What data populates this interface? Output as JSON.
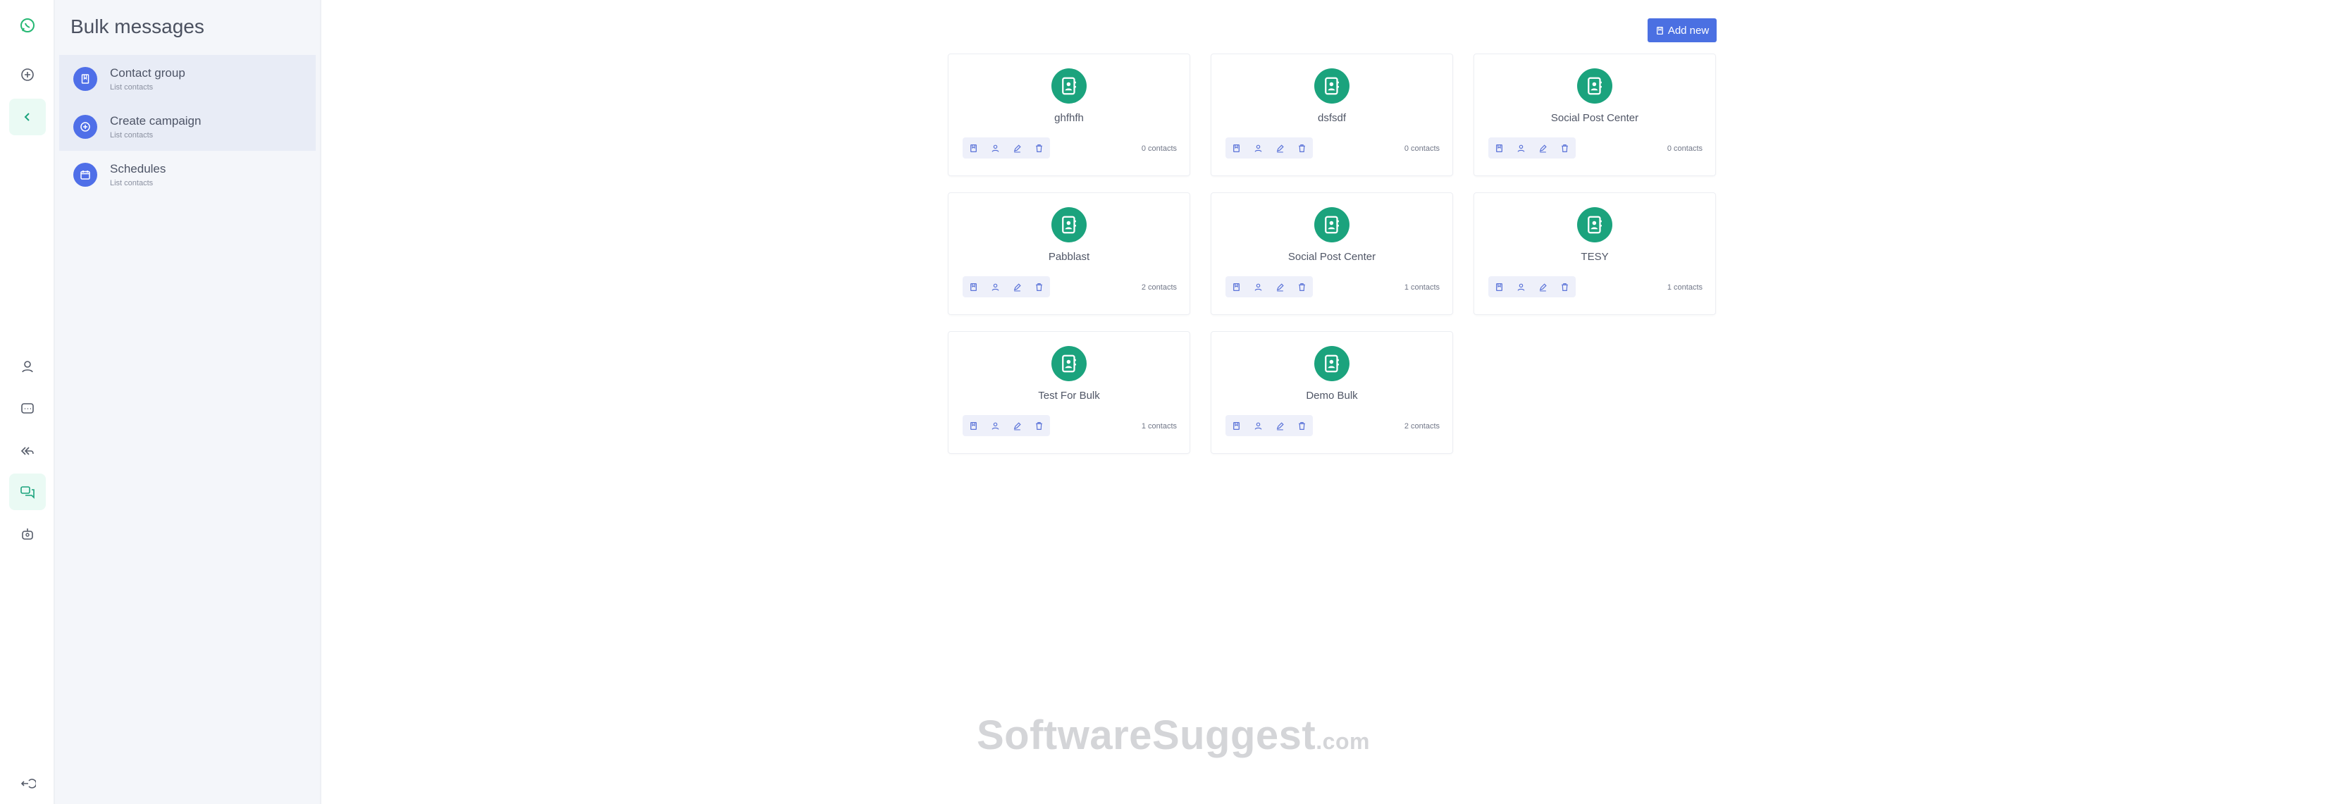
{
  "rail": {
    "icons": [
      "whatsapp-icon",
      "add-circle-icon",
      "chevron-left-icon",
      "contacts-icon",
      "chat-icon",
      "reply-all-icon",
      "bulk-messages-icon",
      "bot-icon",
      "logout-icon"
    ]
  },
  "sidebar": {
    "title": "Bulk messages",
    "items": [
      {
        "label": "Contact group",
        "sub": "List contacts",
        "icon": "book-icon",
        "selected": true
      },
      {
        "label": "Create campaign",
        "sub": "List contacts",
        "icon": "add-circle-icon",
        "selected": true
      },
      {
        "label": "Schedules",
        "sub": "List contacts",
        "icon": "calendar-icon",
        "selected": false
      }
    ]
  },
  "toolbar": {
    "add_new_label": "Add new"
  },
  "groups": [
    {
      "name": "ghfhfh",
      "count": "0 contacts"
    },
    {
      "name": "dsfsdf",
      "count": "0 contacts"
    },
    {
      "name": "Social Post Center",
      "count": "0 contacts"
    },
    {
      "name": "Pabblast",
      "count": "2 contacts"
    },
    {
      "name": "Social Post Center",
      "count": "1 contacts"
    },
    {
      "name": "TESY",
      "count": "1 contacts"
    },
    {
      "name": "Test For Bulk",
      "count": "1 contacts"
    },
    {
      "name": "Demo Bulk",
      "count": "2 contacts"
    }
  ],
  "watermark": {
    "main": "SoftwareSuggest",
    "suffix": ".com"
  },
  "colors": {
    "accent": "#4b70e2",
    "brand_green": "#1ba37d",
    "sidebar_bg": "#f4f6fa"
  }
}
